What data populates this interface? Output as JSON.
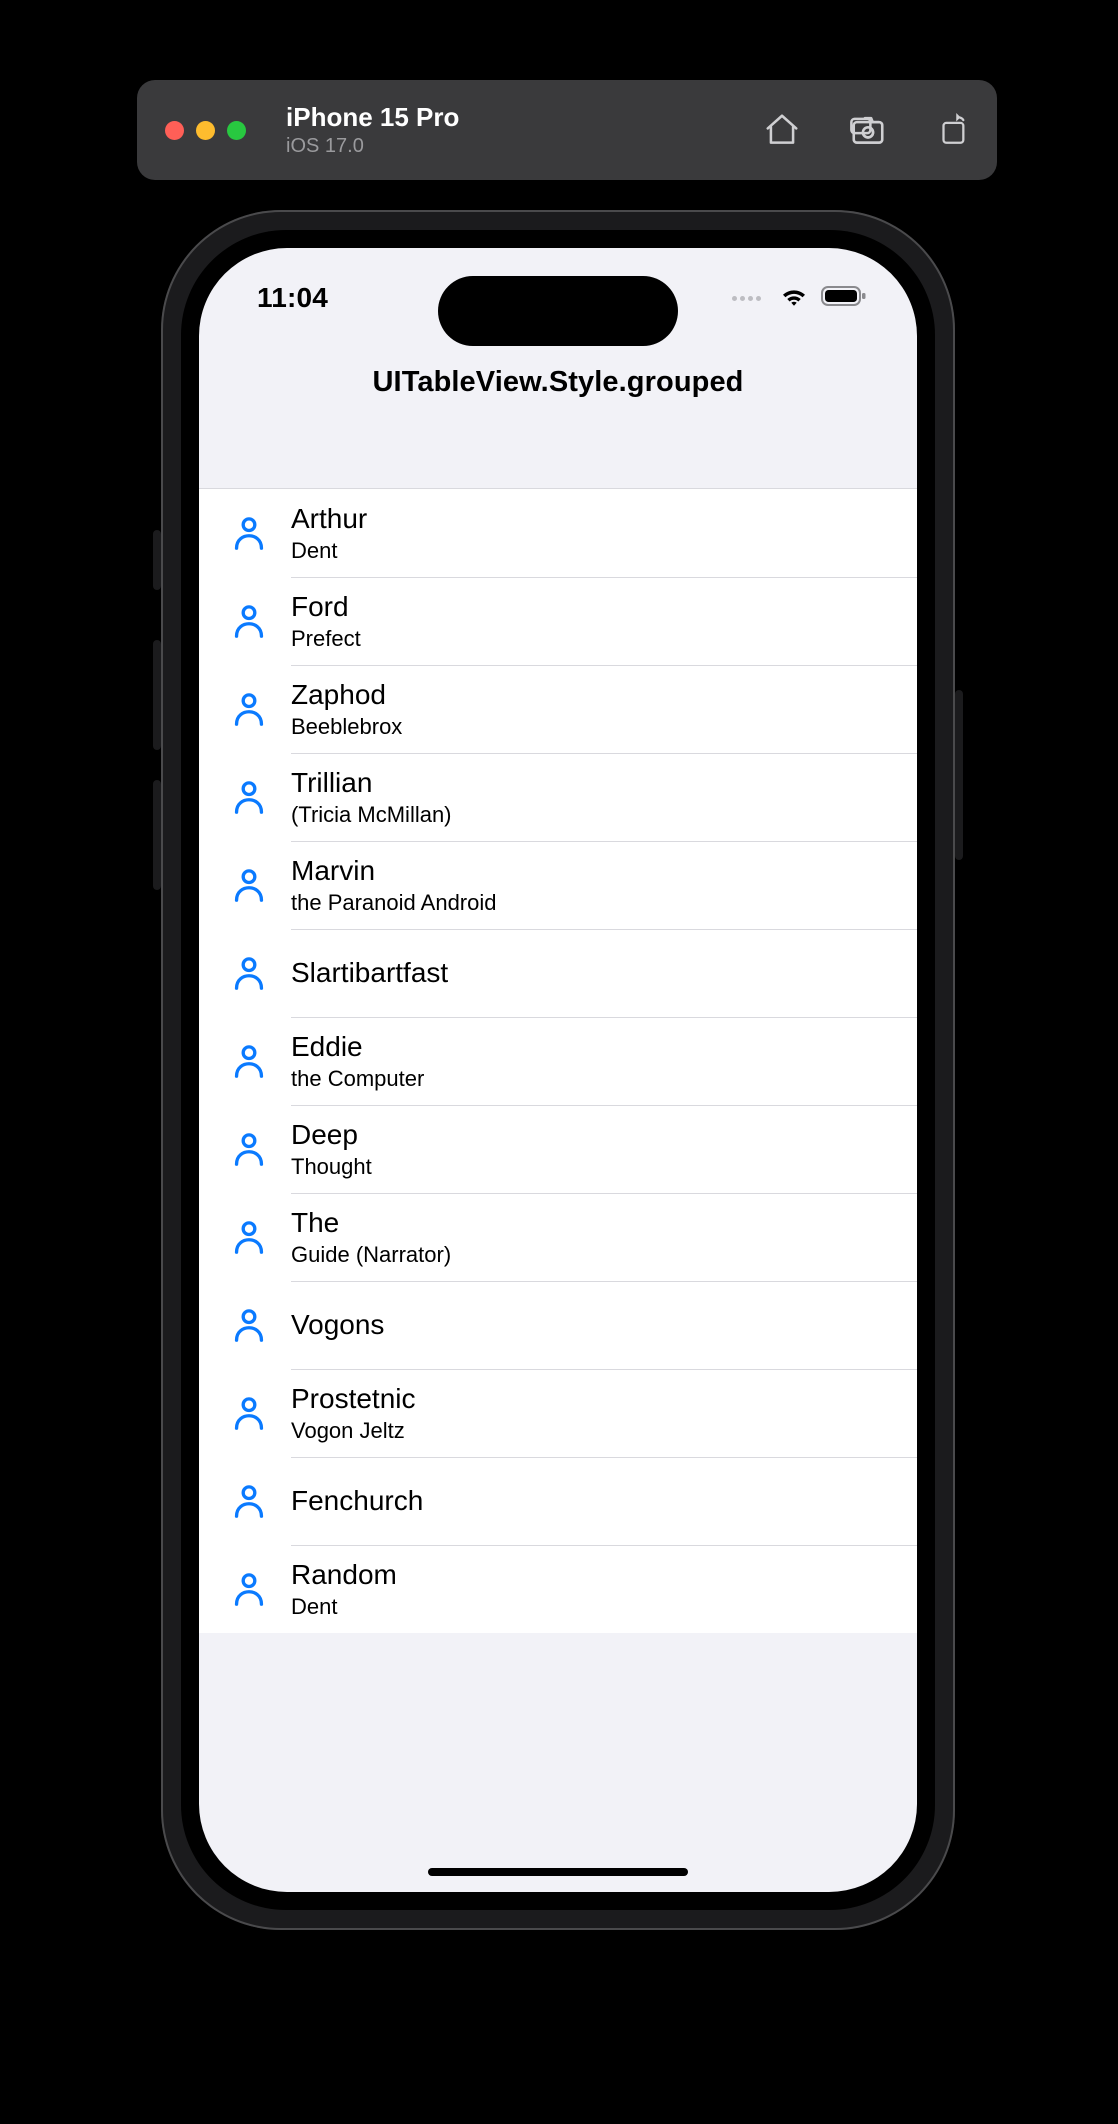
{
  "simulator": {
    "device_name": "iPhone 15 Pro",
    "os_version": "iOS 17.0"
  },
  "status": {
    "time": "11:04"
  },
  "nav": {
    "title": "UITableView.Style.grouped"
  },
  "rows": [
    {
      "title": "Arthur",
      "sub": "Dent"
    },
    {
      "title": "Ford",
      "sub": "Prefect"
    },
    {
      "title": "Zaphod",
      "sub": "Beeblebrox"
    },
    {
      "title": "Trillian",
      "sub": "(Tricia McMillan)"
    },
    {
      "title": "Marvin",
      "sub": "the Paranoid Android"
    },
    {
      "title": "Slartibartfast",
      "sub": ""
    },
    {
      "title": "Eddie",
      "sub": "the Computer"
    },
    {
      "title": "Deep",
      "sub": "Thought"
    },
    {
      "title": "The",
      "sub": "Guide (Narrator)"
    },
    {
      "title": "Vogons",
      "sub": ""
    },
    {
      "title": "Prostetnic",
      "sub": "Vogon Jeltz"
    },
    {
      "title": "Fenchurch",
      "sub": ""
    },
    {
      "title": "Random",
      "sub": "Dent"
    }
  ]
}
